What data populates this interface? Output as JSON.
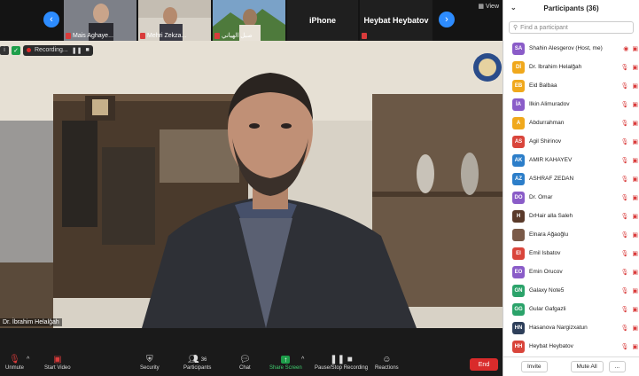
{
  "thumbnails": [
    {
      "name": "Mais Aghaye..."
    },
    {
      "name": "Mehri Zekza..."
    },
    {
      "name": "صبل الهياني"
    },
    {
      "name": "iPhone",
      "text_only": true
    },
    {
      "name": "Heybat Heybatov",
      "text_only": true
    }
  ],
  "view_label": "View",
  "recording_label": "Recording...",
  "speaker_name": "Dr. İbrahim Helalğah",
  "toolbar": {
    "unmute": "Unmute",
    "start_video": "Start Video",
    "security": "Security",
    "participants": "Participants",
    "participants_count": "36",
    "chat": "Chat",
    "share_screen": "Share Screen",
    "pause_recording": "Pause/Stop Recording",
    "reactions": "Reactions",
    "end": "End"
  },
  "panel": {
    "title": "Participants (36)",
    "search_placeholder": "Find a participant",
    "invite": "Invite",
    "mute_all": "Mute All",
    "more": "..."
  },
  "participants": [
    {
      "initials": "SA",
      "color": "#8a5cc8",
      "name": "Shahin Alesgerov (Host, me)"
    },
    {
      "initials": "Dİ",
      "color": "#f0a81c",
      "name": "Dr. İbrahim Helalğah"
    },
    {
      "initials": "EB",
      "color": "#f0a81c",
      "name": "Eid Balbaa"
    },
    {
      "initials": "İA",
      "color": "#8a5cc8",
      "name": "İlkin Alimuradov"
    },
    {
      "initials": "A",
      "color": "#f0a81c",
      "name": "Abdurrahman"
    },
    {
      "initials": "AS",
      "color": "#d9453b",
      "name": "Agil Shirinov"
    },
    {
      "initials": "AK",
      "color": "#2c7ec9",
      "name": "AMIR KAHAYEV"
    },
    {
      "initials": "AZ",
      "color": "#2c7ec9",
      "name": "ASHRAF ZEDAN"
    },
    {
      "initials": "DO",
      "color": "#8a5cc8",
      "name": "Dr. Omar"
    },
    {
      "initials": "H",
      "color": "#5a3a2a",
      "name": "DrHair alla Saleh"
    },
    {
      "initials": "",
      "color": "#7a5a48",
      "name": "Elnara Ağaoğlu"
    },
    {
      "initials": "EI",
      "color": "#d9453b",
      "name": "Emil Isbatov"
    },
    {
      "initials": "EO",
      "color": "#8a5cc8",
      "name": "Emin Orucov"
    },
    {
      "initials": "GN",
      "color": "#2ba36a",
      "name": "Galaxy Note5"
    },
    {
      "initials": "GG",
      "color": "#2ba36a",
      "name": "Gular Gafgazli"
    },
    {
      "initials": "HN",
      "color": "#2e3f5a",
      "name": "Hasanova Nargizxatun"
    },
    {
      "initials": "HH",
      "color": "#d9453b",
      "name": "Heybat Heybatov"
    }
  ]
}
